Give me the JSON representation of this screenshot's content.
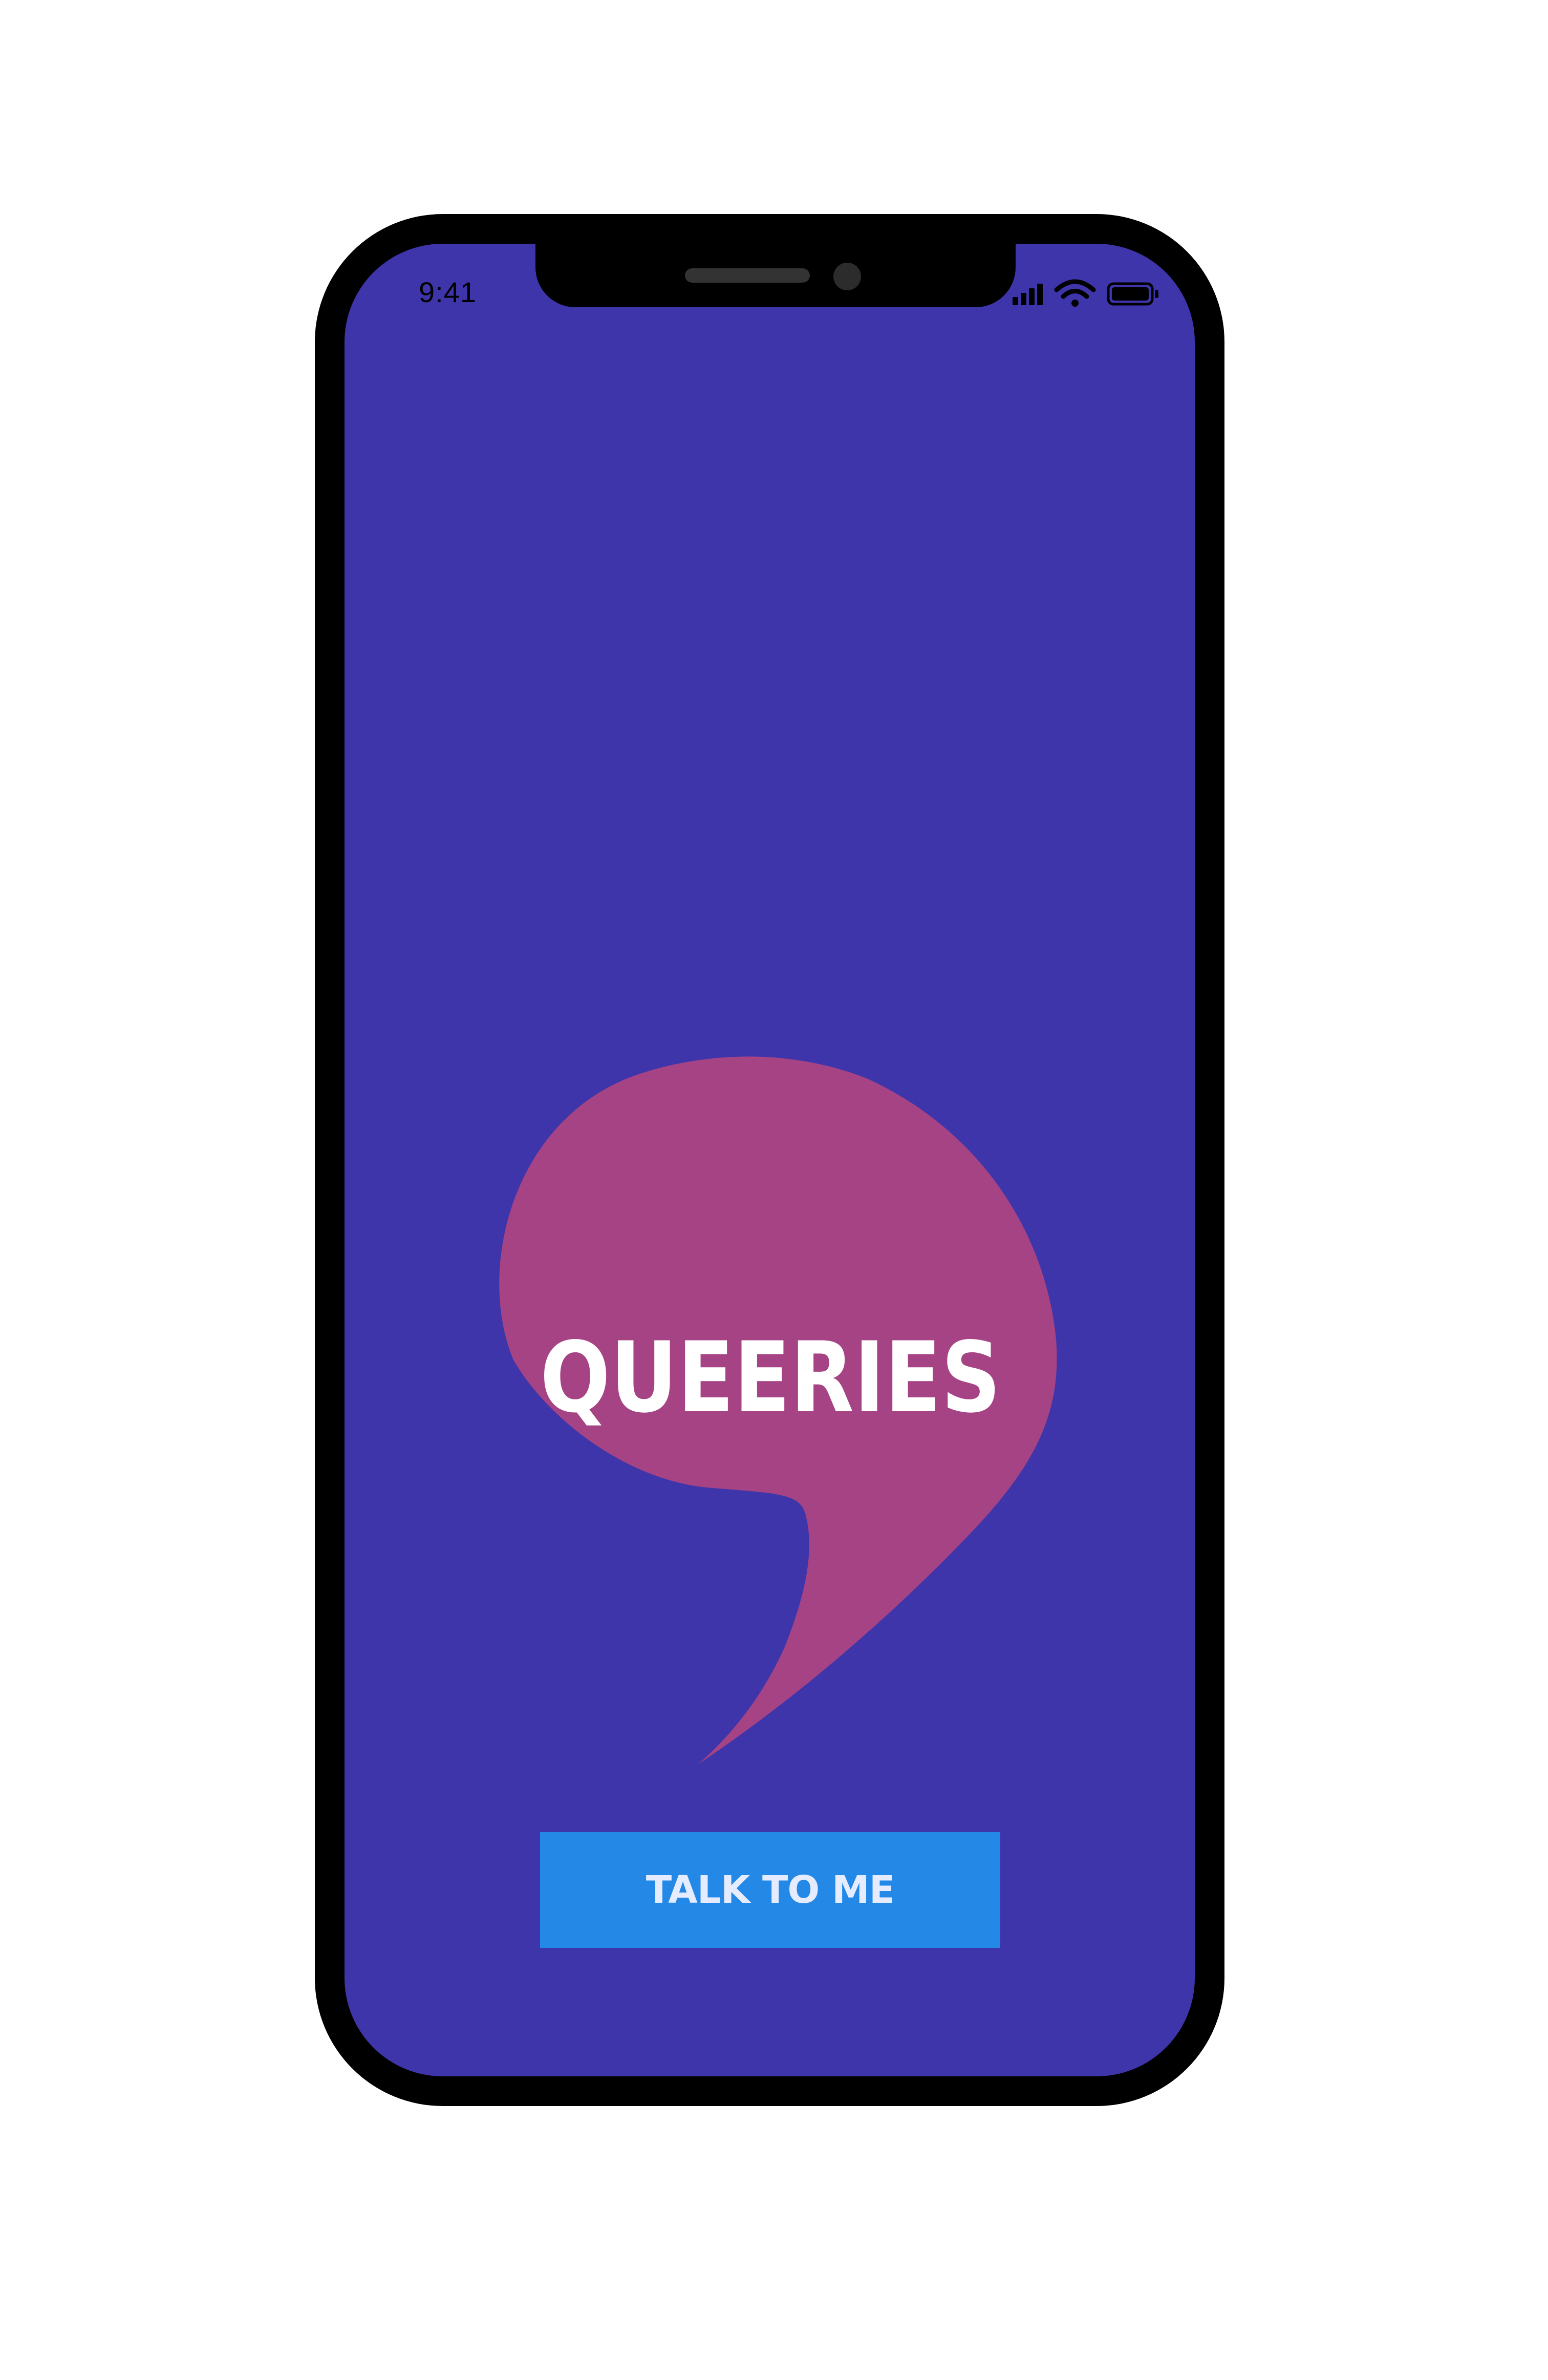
{
  "status_bar": {
    "time": "9:41",
    "icons": [
      "signal-bars-icon",
      "wifi-icon",
      "battery-icon"
    ]
  },
  "logo": {
    "text": "QUEERIES",
    "icon": "speech-bubble-icon"
  },
  "actions": {
    "talk_label": "TALK TO ME"
  },
  "colors": {
    "frame": "#000000",
    "screen_background": "#3e35aa",
    "bubble": "#a54384",
    "logo_text": "#ffffff",
    "button": "#2489e6",
    "button_text": "#e6ecff"
  }
}
